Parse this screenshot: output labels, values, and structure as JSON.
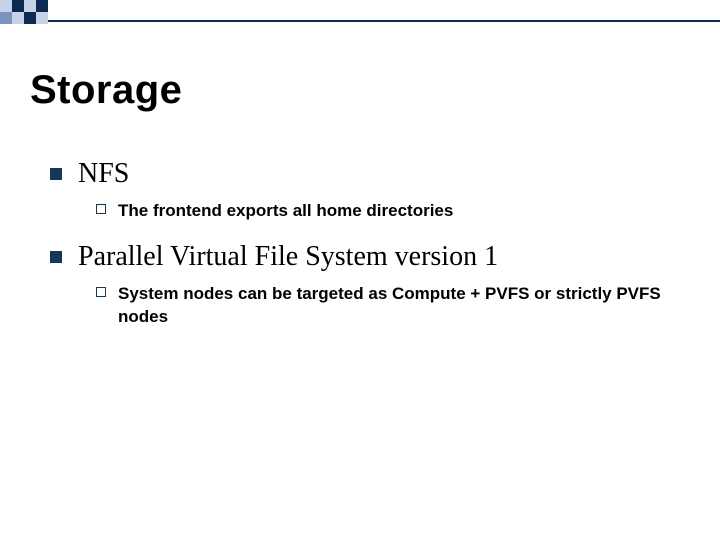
{
  "title": "Storage",
  "items": [
    {
      "label": "NFS",
      "children": [
        {
          "label": "The frontend exports all home directories"
        }
      ]
    },
    {
      "label": "Parallel Virtual File System version 1",
      "children": [
        {
          "label": "System nodes can be targeted as Compute + PVFS or strictly PVFS nodes"
        }
      ]
    }
  ],
  "colors": {
    "bullet": "#17365d",
    "decor_dark": "#0f2a52",
    "decor_mid": "#7b94bd",
    "decor_light": "#c6d2e6"
  }
}
